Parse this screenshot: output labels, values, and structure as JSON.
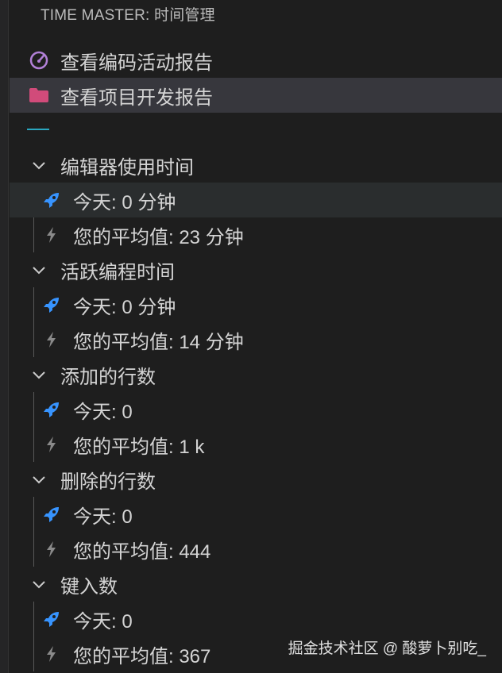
{
  "panel": {
    "title": "TIME MASTER: 时间管理"
  },
  "top_items": [
    {
      "label": "查看编码活动报告",
      "icon": "dashboard-icon",
      "color": "#b180d7"
    },
    {
      "label": "查看项目开发报告",
      "icon": "folder-icon",
      "color": "#d14b7a"
    }
  ],
  "groups": [
    {
      "label": "编辑器使用时间",
      "today": "今天:  0 分钟",
      "average": "您的平均值: 23 分钟"
    },
    {
      "label": "活跃编程时间",
      "today": "今天:  0 分钟",
      "average": "您的平均值: 14 分钟"
    },
    {
      "label": "添加的行数",
      "today": "今天:  0",
      "average": "您的平均值: 1 k"
    },
    {
      "label": "删除的行数",
      "today": "今天:  0",
      "average": "您的平均值: 444"
    },
    {
      "label": "键入数",
      "today": "今天:  0",
      "average": "您的平均值: 367"
    }
  ],
  "colors": {
    "rocket": "#3794ff",
    "bolt": "#8a8a8a",
    "divider": "#2aa7c0"
  },
  "watermark": "掘金技术社区 @ 酸萝卜别吃_"
}
